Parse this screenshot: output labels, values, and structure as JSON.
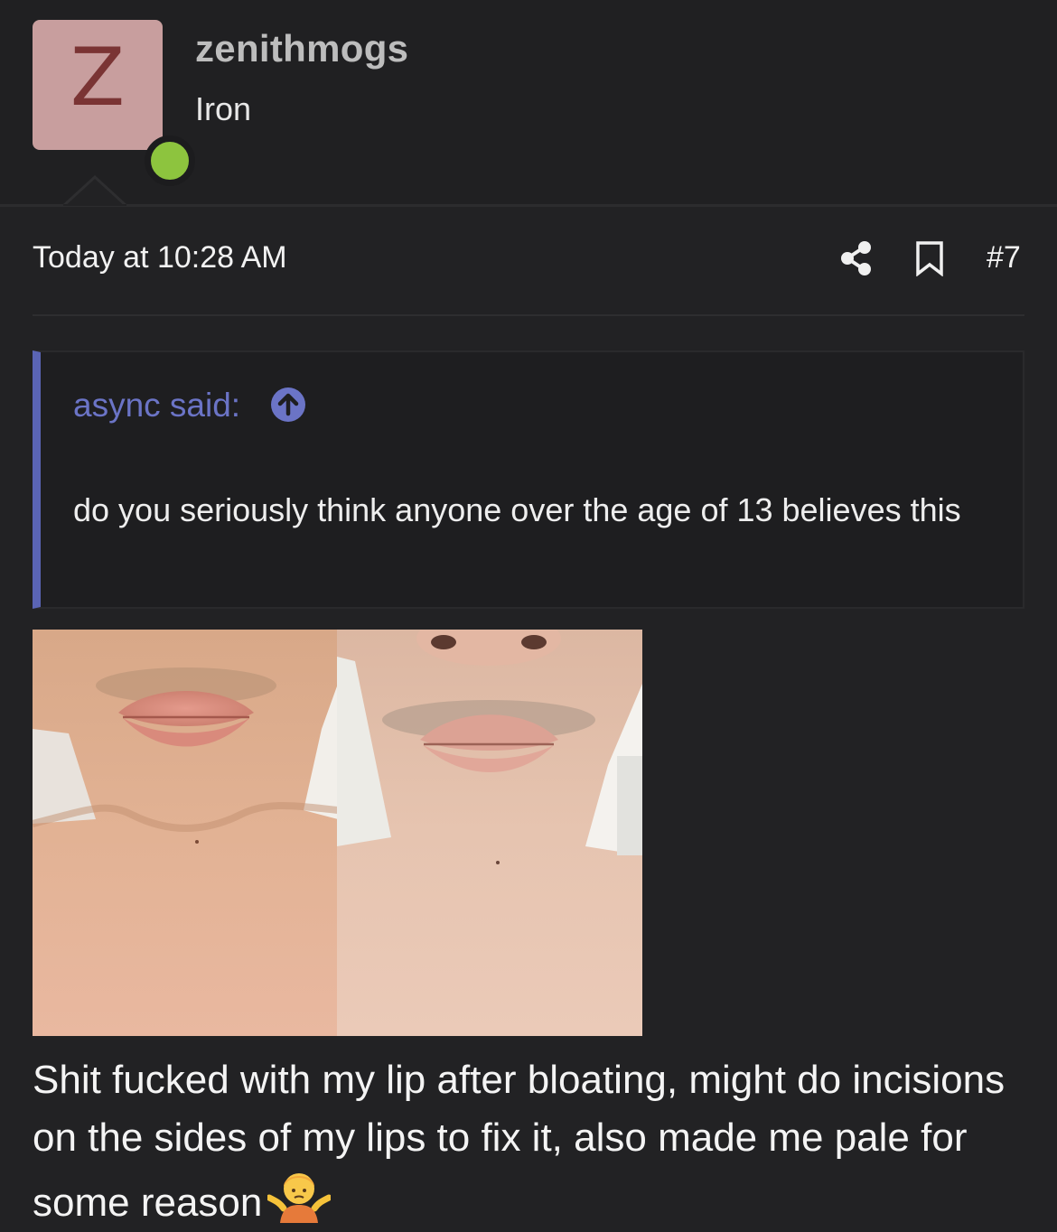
{
  "user": {
    "avatar_letter": "Z",
    "username": "zenithmogs",
    "rank": "Iron",
    "online_status_color": "#8dc43e",
    "avatar_color": "#c89e9e"
  },
  "post": {
    "date": "Today at 10:28 AM",
    "number": "#7",
    "icons": [
      "share-icon",
      "bookmark-icon"
    ]
  },
  "quote": {
    "author_line": "async said:",
    "text": "do you seriously think anyone over the age of 13 believes this",
    "accent_color": "#5a64b4"
  },
  "attachments": {
    "images": [
      "lip-photo-front",
      "lip-photo-lower-angle"
    ]
  },
  "message": {
    "text": "Shit fucked with my lip after bloating, might do incisions on the sides of my lips to fix it, also made me pale for some reason",
    "emoji": "person-shrugging-icon"
  }
}
